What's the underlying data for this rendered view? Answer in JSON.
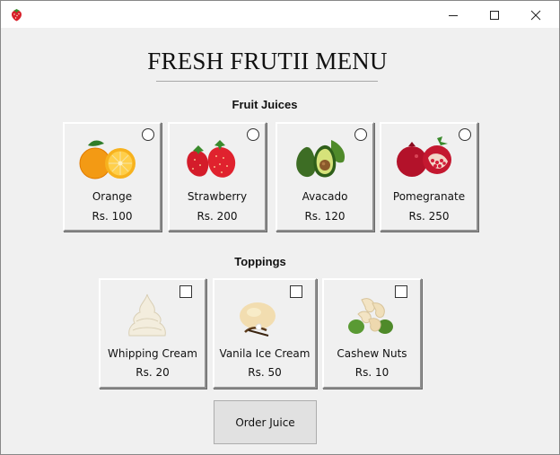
{
  "window": {
    "app_icon": "strawberry-icon",
    "controls": {
      "minimize": "minimize-icon",
      "maximize": "maximize-icon",
      "close": "close-icon"
    }
  },
  "title": "FRESH FRUTII MENU",
  "sections": {
    "juices_label": "Fruit Juices",
    "toppings_label": "Toppings"
  },
  "juices": [
    {
      "name": "Orange",
      "price": "Rs. 100",
      "icon": "orange-icon"
    },
    {
      "name": "Strawberry",
      "price": "Rs. 200",
      "icon": "strawberry-icon"
    },
    {
      "name": "Avacado",
      "price": "Rs. 120",
      "icon": "avocado-icon"
    },
    {
      "name": "Pomegranate",
      "price": "Rs. 250",
      "icon": "pomegranate-icon"
    }
  ],
  "toppings": [
    {
      "name": "Whipping Cream",
      "price": "Rs. 20",
      "icon": "whipped-cream-icon"
    },
    {
      "name": "Vanila Ice Cream",
      "price": "Rs. 50",
      "icon": "ice-cream-icon"
    },
    {
      "name": "Cashew Nuts",
      "price": "Rs. 10",
      "icon": "cashew-icon"
    }
  ],
  "order_button": "Order Juice",
  "colors": {
    "window_bg": "#f0f0f0",
    "titlebar_bg": "#ffffff",
    "button_bg": "#e1e1e1"
  }
}
